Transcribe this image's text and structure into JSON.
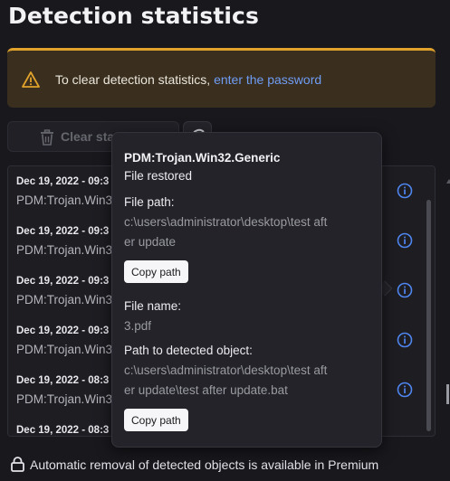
{
  "page": {
    "title": "Detection statistics"
  },
  "banner": {
    "icon": "warning-triangle-icon",
    "text": "To clear detection statistics, ",
    "link": "enter the password",
    "accent": "#e0a22a"
  },
  "toolbar": {
    "clear_label": "Clear statistics",
    "clear_icon": "trash-icon",
    "refresh_icon": "refresh-icon"
  },
  "detections": [
    {
      "date": "Dec 19, 2022 - 09:3",
      "threat": "PDM:Trojan.Win3"
    },
    {
      "date": "Dec 19, 2022 - 09:3",
      "threat": "PDM:Trojan.Win3"
    },
    {
      "date": "Dec 19, 2022 - 09:3",
      "threat": "PDM:Trojan.Win3"
    },
    {
      "date": "Dec 19, 2022 - 09:3",
      "threat": "PDM:Trojan.Win3"
    },
    {
      "date": "Dec 19, 2022 - 08:3",
      "threat": "PDM:Trojan.Win3"
    },
    {
      "date": "Dec 19, 2022 - 08:3",
      "threat": ""
    }
  ],
  "tooltip": {
    "threat": "PDM:Trojan.Win32.Generic",
    "status": "File restored",
    "file_path_label": "File path:",
    "file_path_line1": "c:\\users\\administrator\\desktop\\test aft",
    "file_path_line2": "er update",
    "copy_label": "Copy path",
    "file_name_label": "File name:",
    "file_name": "3.pdf",
    "object_path_label": "Path to detected object:",
    "object_path_line1": "c:\\users\\administrator\\desktop\\test aft",
    "object_path_line2": "er update\\test after update.bat",
    "copy_label_2": "Copy path"
  },
  "footer": {
    "icon": "lock-icon",
    "text": "Automatic removal of detected objects is available in Premium"
  },
  "colors": {
    "background": "#18181d",
    "link": "#6f9cf5",
    "info_icon": "#4f86f0"
  }
}
